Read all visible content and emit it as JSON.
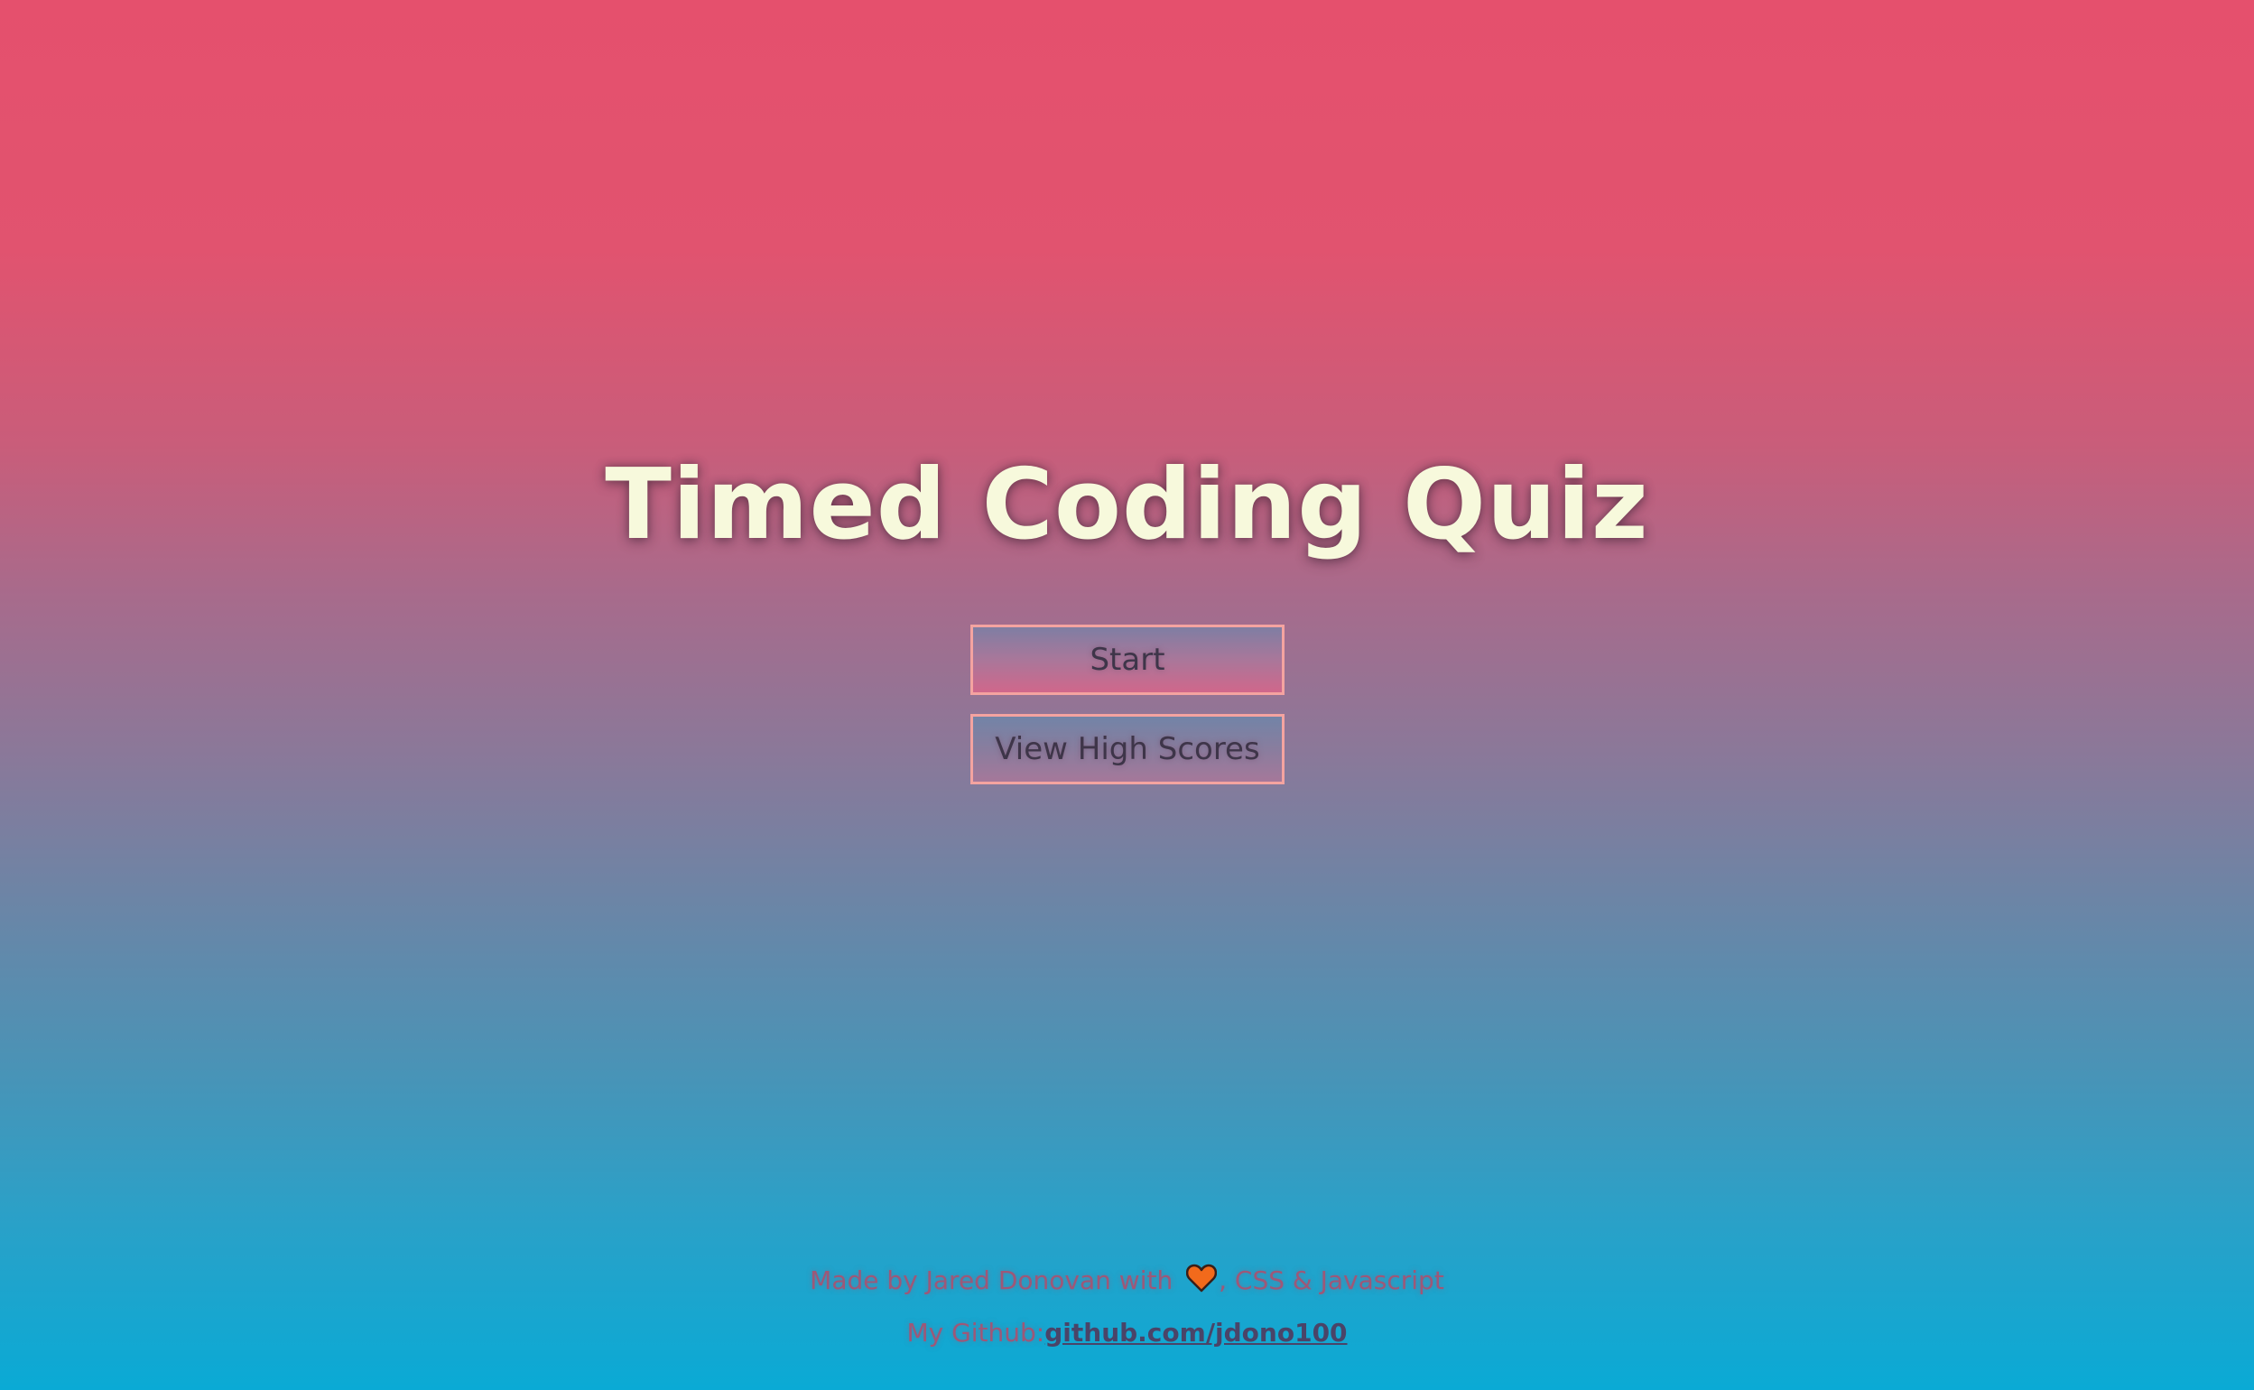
{
  "main": {
    "title": "Timed Coding Quiz",
    "start_label": "Start",
    "high_scores_label": "View High Scores"
  },
  "footer": {
    "made_by_prefix": "Made by Jared Donovan with",
    "made_by_suffix": ", CSS & Javascript",
    "heart_icon": "heart-icon",
    "heart_color": "#f26a1b",
    "github_label": "My Github:",
    "github_link": "github.com/jdono100"
  },
  "colors": {
    "title": "#f7f9dc",
    "button_border": "#f4a3a0",
    "gradient_top": "#e5506d",
    "gradient_bottom": "#0aaad5"
  }
}
